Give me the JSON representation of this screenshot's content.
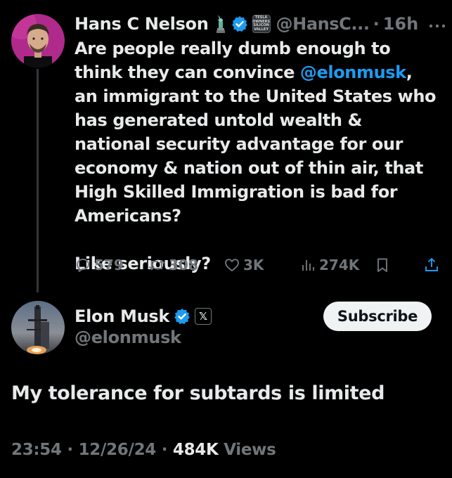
{
  "colors": {
    "background": "#000000",
    "text": "#e7e9ea",
    "muted": "#71767b",
    "link": "#1d9bf0",
    "verified": "#1d9bf0",
    "subscribe_bg": "#eff3f4"
  },
  "parent_post": {
    "author_name": "Hans C Nelson",
    "name_emoji_icon": "statue-of-liberty-icon",
    "verified_icon": "verified-badge-icon",
    "affiliate_badge_lines": [
      "TESLA",
      "OWNERS",
      "SILICON",
      "VALLEY"
    ],
    "handle": "@HansC...",
    "separator": "·",
    "time": "16h",
    "more_icon": "more-options-icon",
    "text_before_mention": "Are people really dumb enough to think they can convince ",
    "mention": "@elonmusk",
    "text_after_mention": ", an immigrant to the United States who has generated untold wealth & national security advantage for our economy & nation out of thin air, that High Skilled Immigration is bad for Americans?",
    "text_second_paragraph": "Like seriously?",
    "replies": "579",
    "reposts": "308",
    "likes": "3K",
    "views": "274K",
    "reply_icon": "reply-icon",
    "repost_icon": "repost-icon",
    "like_icon": "heart-icon",
    "views_icon": "views-chart-icon",
    "bookmark_icon": "bookmark-icon",
    "share_icon": "share-icon"
  },
  "reply_post": {
    "author_name": "Elon Musk",
    "verified_icon": "verified-badge-icon",
    "affiliate_badge": "𝕏",
    "handle": "@elonmusk",
    "subscribe_label": "Subscribe",
    "text": "My tolerance for subtards is limited",
    "time": "23:54",
    "separator1": " · ",
    "date": "12/26/24",
    "separator2": " · ",
    "views_count": "484K",
    "views_label": " Views"
  }
}
